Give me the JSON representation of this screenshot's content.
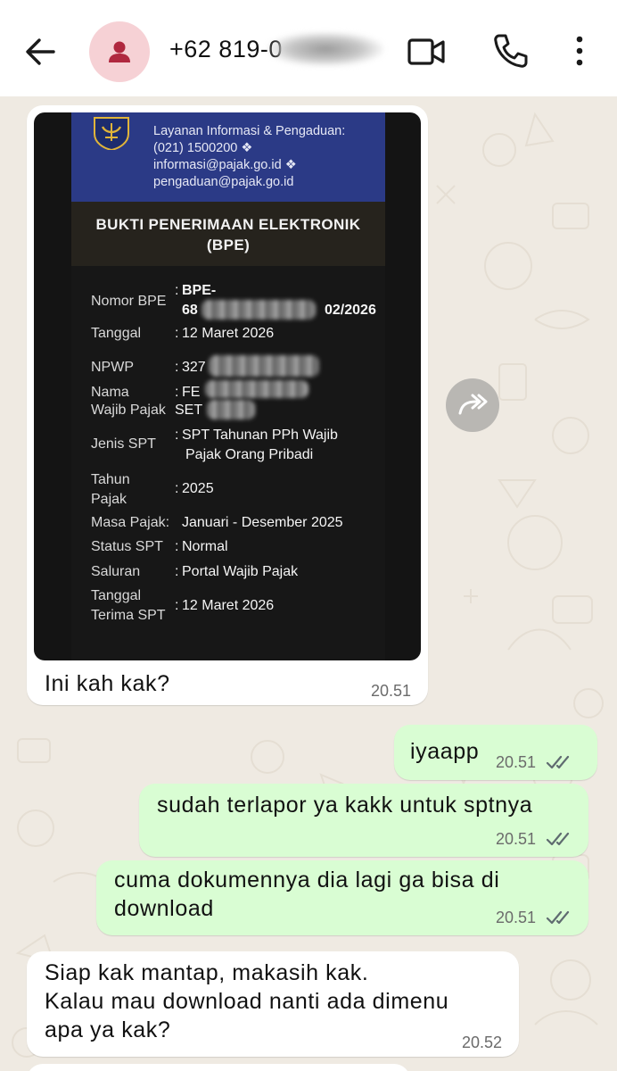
{
  "header": {
    "contact": "+62 819-0",
    "icons": [
      "back-arrow-icon",
      "person-icon",
      "video-call-icon",
      "phone-icon",
      "more-vert-icon"
    ]
  },
  "attachment": {
    "agency_lines": [
      "Layanan Informasi & Pengaduan:",
      "(021) 1500200 ❖",
      "informasi@pajak.go.id ❖",
      "pengaduan@pajak.go.id"
    ],
    "title_line1": "BUKTI PENERIMAAN ELEKTRONIK",
    "title_line2": "(BPE)",
    "rows": {
      "nomor_bpe": {
        "label": "Nomor BPE",
        "value_line1": "BPE-",
        "value_line2": "68",
        "value_suffix": "02/2026"
      },
      "tanggal": {
        "label": "Tanggal",
        "value": "12 Maret 2026"
      },
      "npwp": {
        "label": "NPWP",
        "value": "327"
      },
      "nama": {
        "label_line1": "Nama",
        "label_line2": "Wajib Pajak",
        "value_line1": "FE",
        "value_line2": "SET"
      },
      "jenis_spt": {
        "label": "Jenis SPT",
        "value_line1": "SPT Tahunan PPh Wajib",
        "value_line2": "Pajak Orang Pribadi"
      },
      "tahun_pajak": {
        "label_line1": "Tahun",
        "label_line2": "Pajak",
        "value": "2025"
      },
      "masa_pajak": {
        "label": "Masa Pajak:",
        "value": "Januari - Desember 2025"
      },
      "status_spt": {
        "label": "Status SPT",
        "value": "Normal"
      },
      "saluran": {
        "label": "Saluran",
        "value": "Portal Wajib Pajak"
      },
      "tanggal_terima": {
        "label_line1": "Tanggal",
        "label_line2": "Terima SPT",
        "value": "12 Maret 2026"
      }
    }
  },
  "messages": [
    {
      "side": "in",
      "text": "Ini kah kak?",
      "time": "20.51"
    },
    {
      "side": "out",
      "text": "iyaapp",
      "time": "20.51",
      "status": "read"
    },
    {
      "side": "out",
      "text": "sudah terlapor ya kakk untuk sptnya",
      "time": "20.51",
      "status": "read"
    },
    {
      "side": "out",
      "text_line1": "cuma dokumennya dia lagi ga bisa di",
      "text_line2": "download",
      "time": "20.51",
      "status": "read"
    },
    {
      "side": "in",
      "text_line1": "Siap kak mantap, makasih kak.",
      "text_line2": "Kalau mau download nanti ada dimenu",
      "text_line3": "apa ya kak?",
      "time": "20.52"
    }
  ],
  "colors": {
    "header_bg": "#ffffff",
    "chat_bg": "#efeae2",
    "incoming_bubble": "#ffffff",
    "outgoing_bubble": "#d9fdd3",
    "avatar_bg": "#f6d1d5",
    "avatar_icon": "#b0283f",
    "doc_header": "#2b3a86"
  }
}
